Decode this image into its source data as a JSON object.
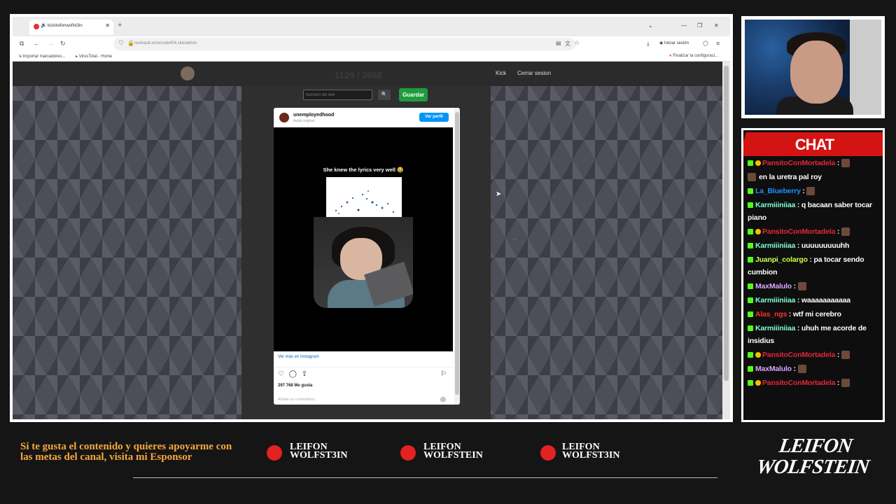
{
  "browser": {
    "tab_title": "kick/leifonwolfst3in",
    "new_tab": "+",
    "url": "reelvault.errorcode404.site/admin",
    "bookmarks": [
      {
        "label": "Importar marcadores..."
      },
      {
        "label": "VirusTotal - Home"
      }
    ],
    "sign_in": "Iniciar sesión",
    "finish_setup": "Finalizar la configuraci..."
  },
  "site": {
    "ghost_title": "1129 / 3668",
    "nav_kick": "Kick",
    "nav_logout": "Cerrar sesion",
    "reel_placeholder": "Número de reel",
    "save": "Guardar"
  },
  "instagram": {
    "username": "unemployedhood",
    "audio": "Audio original",
    "follow": "Ver perfil",
    "caption": "She knew the lyrics very well 😂",
    "see_more": "Ver más en Instagram",
    "likes": "297 768 Me gusta",
    "comment_placeholder": "Añade un comentario..."
  },
  "chat": {
    "title": "CHAT",
    "messages": [
      {
        "user": "PansitoConMortadela",
        "color": "#e0273a",
        "text": ""
      },
      {
        "user": "",
        "color": "#ffffff",
        "text": "en la uretra pal roy"
      },
      {
        "user": "La_Blueberry",
        "color": "#1e90ff",
        "text": ""
      },
      {
        "user": "Karmiiiniiaa",
        "color": "#7fffd4",
        "text": "q bacaan saber tocar piano"
      },
      {
        "user": "PansitoConMortadela",
        "color": "#e0273a",
        "text": ""
      },
      {
        "user": "Karmiiiniiaa",
        "color": "#7fffd4",
        "text": "uuuuuuuuuhh"
      },
      {
        "user": "Juanpi_colargo",
        "color": "#d2ff4d",
        "text": "pa tocar sendo cumbion"
      },
      {
        "user": "MaxMalulo",
        "color": "#d9a6ff",
        "text": ""
      },
      {
        "user": "Karmiiiniiaa",
        "color": "#7fffd4",
        "text": "waaaaaaaaaaa"
      },
      {
        "user": "Alas_ngs",
        "color": "#ff3030",
        "text": "wtf mi cerebro"
      },
      {
        "user": "Karmiiiniiaa",
        "color": "#7fffd4",
        "text": "uhuh me acorde de insidius"
      },
      {
        "user": "PansitoConMortadela",
        "color": "#e0273a",
        "text": ""
      },
      {
        "user": "MaxMalulo",
        "color": "#d9a6ff",
        "text": ""
      },
      {
        "user": "PansitoConMortadela",
        "color": "#e0273a",
        "text": ""
      }
    ]
  },
  "overlay": {
    "promo": "Si te gusta el contenido y quieres apoyarme con las metas del canal, visita mi Esponsor",
    "youtube": "LEIFON WOLFST3IN",
    "instagram": "LEIFON WOLFSTEIN",
    "tiktok": "LEIFON WOLFST3IN",
    "brand_line1": "LEIFON",
    "brand_line2": "WOLFSTEIN",
    "accent": "#d41313"
  }
}
